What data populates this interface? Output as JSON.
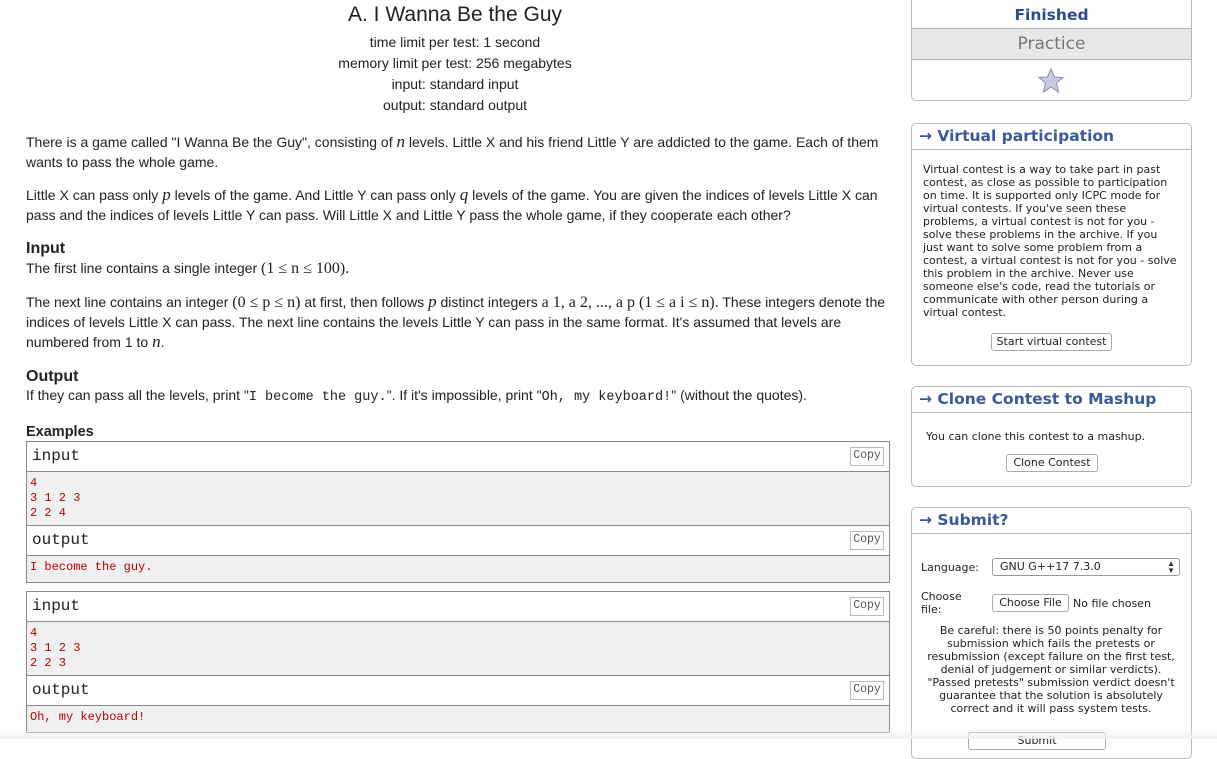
{
  "problem": {
    "title": "A. I Wanna Be the Guy",
    "limits": [
      "time limit per test: 1 second",
      "memory limit per test: 256 megabytes",
      "input: standard input",
      "output: standard output"
    ],
    "statement_p1_a": "There is a game called \"I Wanna Be the Guy\", consisting of ",
    "var_n": "n",
    "statement_p1_b": " levels. Little X and his friend Little Y are addicted to the game. Each of them wants to pass the whole game.",
    "statement_p2_a": "Little X can pass only ",
    "var_p": "p",
    "statement_p2_b": " levels of the game. And Little Y can pass only ",
    "var_q": "q",
    "statement_p2_c": " levels of the game. You are given the indices of levels Little X can pass and the indices of levels Little Y can pass. Will Little X and Little Y pass the whole game, if they cooperate each other?",
    "input_heading": "Input",
    "input_p1_a": "The first line contains a single integer ",
    "input_p1_math": "(1 ≤ n ≤ 100).",
    "input_p2_a": "The next line contains an integer ",
    "input_p2_math1": "(0 ≤ p ≤ n)",
    "input_p2_b": " at first, then follows ",
    "input_p2_c": " distinct integers ",
    "input_p2_math2": "a 1, a 2, ..., a p (1 ≤ a i ≤ n).",
    "input_p2_d": " These integers denote the indices of levels Little X can pass. The next line contains the levels Little Y can pass in the same format. It's assumed that levels are numbered from 1 to ",
    "input_p2_end": ".",
    "output_heading": "Output",
    "output_a": "If they can pass all the levels, print \"",
    "output_mono1": "I become the guy.",
    "output_b": "\". If it's impossible, print \"",
    "output_mono2": "Oh, my keyboard!",
    "output_c": "\" (without the quotes).",
    "examples_heading": "Examples",
    "input_label": "input",
    "output_label": "output",
    "copy_label": "Copy",
    "ex1_input": "4\n3 1 2 3\n2 2 4",
    "ex1_output": "I become the guy.",
    "ex2_input": "4\n3 1 2 3\n2 2 3",
    "ex2_output": "Oh, my keyboard!"
  },
  "sidebar": {
    "status_finished": "Finished",
    "status_practice": "Practice",
    "star_icon": "star-icon",
    "virtual_title": "→ Virtual participation",
    "virtual_text": "Virtual contest is a way to take part in past contest, as close as possible to participation on time. It is supported only ICPC mode for virtual contests. If you've seen these problems, a virtual contest is not for you - solve these problems in the archive. If you just want to solve some problem from a contest, a virtual contest is not for you - solve this problem in the archive. Never use someone else's code, read the tutorials or communicate with other person during a virtual contest.",
    "virtual_button": "Start virtual contest",
    "clone_title": "→ Clone Contest to Mashup",
    "clone_text": "You can clone this contest to a mashup.",
    "clone_button": "Clone Contest",
    "submit_title": "→ Submit?",
    "language_label": "Language:",
    "language_value": "GNU G++17 7.3.0",
    "choose_label": "Choose file:",
    "choose_button": "Choose File",
    "no_file": "No file chosen",
    "careful_text": "Be careful: there is 50 points penalty for submission which fails the pretests or resubmission (except failure on the first test, denial of judgement or similar verdicts). \"Passed pretests\" submission verdict doesn't guarantee that the solution is absolutely correct and it will pass system tests.",
    "submit_button": "Submit"
  },
  "colors": {
    "link_blue": "#3b5998",
    "example_red": "#bb0000",
    "finished_blue": "#2a4c8f"
  }
}
